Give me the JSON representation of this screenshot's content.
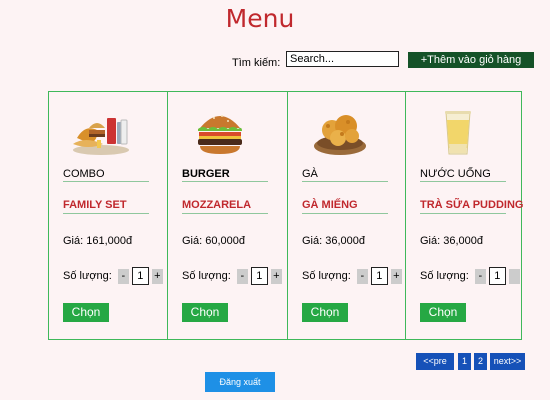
{
  "page": {
    "title": "Menu"
  },
  "search": {
    "label": "Tìm kiếm:",
    "placeholder": "Search..."
  },
  "cart_button": "+Thêm vào giỏ hàng",
  "products": [
    {
      "category": "COMBO",
      "name": "FAMILY SET",
      "price": "Giá: 161,000đ",
      "qty_label": "Số lượng:",
      "qty": "1",
      "minus": "-",
      "plus": "+",
      "choose": "Chọn"
    },
    {
      "category": "BURGER",
      "name": "MOZZARELA",
      "price": "Giá: 60,000đ",
      "qty_label": "Số lượng:",
      "qty": "1",
      "minus": "-",
      "plus": "+",
      "choose": "Chọn"
    },
    {
      "category": "GÀ",
      "name": "GÀ MIẾNG",
      "price": "Giá: 36,000đ",
      "qty_label": "Số lượng:",
      "qty": "1",
      "minus": "-",
      "plus": "+",
      "choose": "Chọn"
    },
    {
      "category": "NƯỚC UỐNG",
      "name": "TRÀ SỮA PUDDING",
      "price": "Giá: 36,000đ",
      "qty_label": "Số lượng:",
      "qty": "1",
      "minus": "-",
      "plus": "",
      "choose": "Chọn"
    }
  ],
  "pagination": {
    "prev": "<<pre",
    "pages": [
      "1",
      "2"
    ],
    "next": "next>>"
  },
  "logout": "Đăng xuất",
  "icons": [
    "combo-meal-icon",
    "burger-icon",
    "fried-chicken-icon",
    "milk-tea-icon"
  ],
  "colors": {
    "accent_red": "#c0282d",
    "green": "#26a844",
    "dark_green": "#155228",
    "pager_blue": "#1651b8",
    "logout_blue": "#1e90e6"
  }
}
